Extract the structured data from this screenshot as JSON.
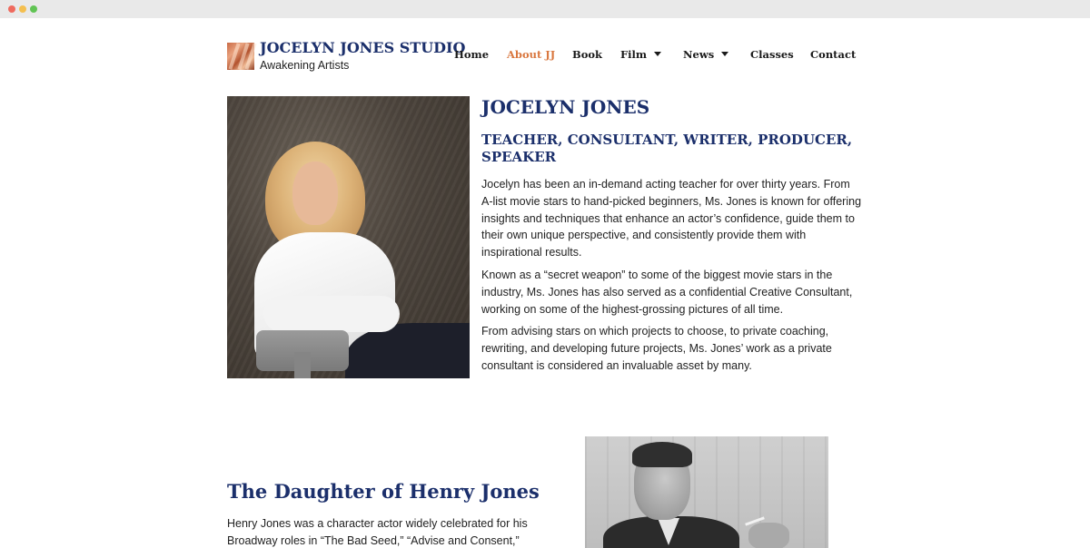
{
  "window": {
    "dot_colors": {
      "red": "#ef6a5e",
      "yellow": "#f4bf4f",
      "green": "#61c454"
    }
  },
  "header": {
    "site_title": "JOCELYN JONES STUDIO",
    "tagline": "Awakening Artists",
    "nav": [
      {
        "label": "Home",
        "active": false,
        "dropdown": false
      },
      {
        "label": "About JJ",
        "active": true,
        "dropdown": false
      },
      {
        "label": "Book",
        "active": false,
        "dropdown": false
      },
      {
        "label": "Film",
        "active": false,
        "dropdown": true
      },
      {
        "label": "News",
        "active": false,
        "dropdown": true
      },
      {
        "label": "Classes",
        "active": false,
        "dropdown": false
      },
      {
        "label": "Contact",
        "active": false,
        "dropdown": false
      }
    ]
  },
  "bio": {
    "name": "JOCELYN JONES",
    "roles": "TEACHER, CONSULTANT, WRITER, PRODUCER, SPEAKER",
    "paragraphs": [
      "Jocelyn has been an in-demand acting teacher for over thirty years. From A-list movie stars to hand-picked beginners, Ms. Jones is known for offering insights and techniques that enhance an actor’s confidence, guide them to their own unique perspective, and consistently provide them with inspirational results.",
      "Known as a “secret weapon” to some of the biggest movie stars in the industry, Ms. Jones has also served as a confidential Creative Consultant, working on some of the highest-grossing pictures of all time.",
      "From advising stars on which projects to choose, to private coaching, rewriting, and developing future projects, Ms. Jones’ work as a private consultant is considered an invaluable asset by many."
    ]
  },
  "section2": {
    "title": "The Daughter of Henry Jones",
    "paragraph": "Henry Jones was a character actor widely celebrated for his Broadway roles in “The Bad Seed,” “Advise and Consent,” and"
  },
  "colors": {
    "heading_navy": "#1b2f6b",
    "nav_active": "#d9773f",
    "body_text": "#222222"
  }
}
